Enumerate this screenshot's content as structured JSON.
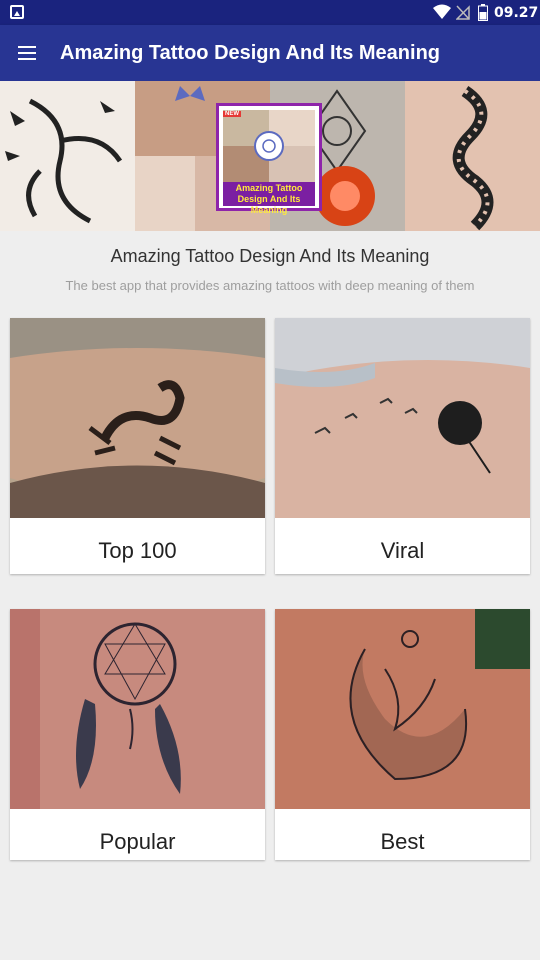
{
  "status_bar": {
    "time": "09.27",
    "icons": [
      "image-notification-icon",
      "wifi-icon",
      "no-sim-icon",
      "battery-icon"
    ]
  },
  "app_bar": {
    "title": "Amazing Tattoo Design And Its Meaning",
    "menu_icon": "hamburger-menu-icon"
  },
  "banner": {
    "logo_badge": "NEW",
    "logo_caption": "Amazing Tattoo Design And Its Meaning"
  },
  "header": {
    "title": "Amazing Tattoo Design And Its Meaning",
    "subtitle": "The best app that provides amazing tattoos with deep meaning of them"
  },
  "categories": [
    {
      "label": "Top 100"
    },
    {
      "label": "Viral"
    },
    {
      "label": "Popular"
    },
    {
      "label": "Best"
    }
  ],
  "colors": {
    "status_bar": "#1a237e",
    "app_bar": "#283593",
    "background": "#eeeeee",
    "logo_border": "#8e24aa"
  }
}
